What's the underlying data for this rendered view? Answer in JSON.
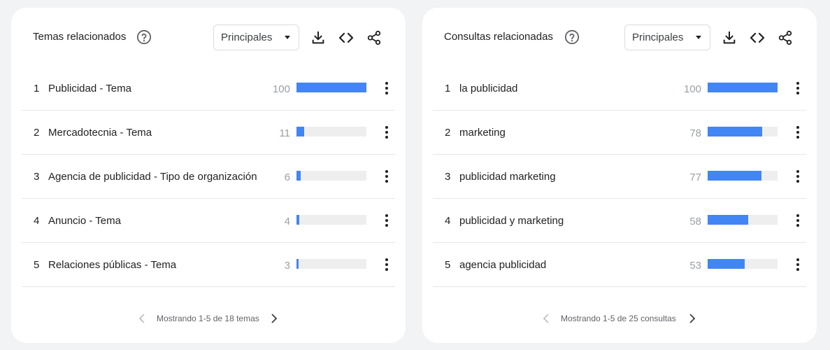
{
  "panels": [
    {
      "title": "Temas relacionados",
      "dropdown": "Principales",
      "rows": [
        {
          "rank": "1",
          "label": "Publicidad - Tema",
          "value": 100
        },
        {
          "rank": "2",
          "label": "Mercadotecnia - Tema",
          "value": 11
        },
        {
          "rank": "3",
          "label": "Agencia de publicidad - Tipo de organización",
          "value": 6
        },
        {
          "rank": "4",
          "label": "Anuncio - Tema",
          "value": 4
        },
        {
          "rank": "5",
          "label": "Relaciones públicas - Tema",
          "value": 3
        }
      ],
      "pager": "Mostrando 1-5 de 18 temas"
    },
    {
      "title": "Consultas relacionadas",
      "dropdown": "Principales",
      "rows": [
        {
          "rank": "1",
          "label": "la publicidad",
          "value": 100
        },
        {
          "rank": "2",
          "label": "marketing",
          "value": 78
        },
        {
          "rank": "3",
          "label": "publicidad marketing",
          "value": 77
        },
        {
          "rank": "4",
          "label": "publicidad y marketing",
          "value": 58
        },
        {
          "rank": "5",
          "label": "agencia publicidad",
          "value": 53
        }
      ],
      "pager": "Mostrando 1-5 de 25 consultas"
    }
  ],
  "colors": {
    "bar_fill": "#4285f4",
    "bar_track": "#eeeeee",
    "background": "#f1f3f4"
  },
  "icons": {
    "help": "help-circle-icon",
    "download": "download-icon",
    "embed": "code-icon",
    "share": "share-icon",
    "more": "more-vert-icon",
    "prev": "chevron-left-icon",
    "next": "chevron-right-icon"
  }
}
